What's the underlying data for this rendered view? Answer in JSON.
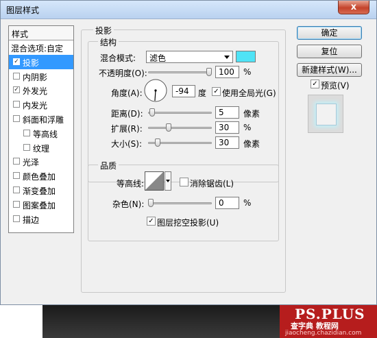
{
  "window": {
    "title": "图层样式",
    "close": "x"
  },
  "styles": {
    "header": "样式",
    "items": [
      {
        "label": "混合选项:自定",
        "checkbox": false,
        "checked": false,
        "indent": false,
        "selected": false
      },
      {
        "label": "投影",
        "checkbox": true,
        "checked": true,
        "indent": false,
        "selected": true
      },
      {
        "label": "内阴影",
        "checkbox": true,
        "checked": false,
        "indent": false,
        "selected": false
      },
      {
        "label": "外发光",
        "checkbox": true,
        "checked": true,
        "indent": false,
        "selected": false
      },
      {
        "label": "内发光",
        "checkbox": true,
        "checked": false,
        "indent": false,
        "selected": false
      },
      {
        "label": "斜面和浮雕",
        "checkbox": true,
        "checked": false,
        "indent": false,
        "selected": false
      },
      {
        "label": "等高线",
        "checkbox": true,
        "checked": false,
        "indent": true,
        "selected": false
      },
      {
        "label": "纹理",
        "checkbox": true,
        "checked": false,
        "indent": true,
        "selected": false
      },
      {
        "label": "光泽",
        "checkbox": true,
        "checked": false,
        "indent": false,
        "selected": false
      },
      {
        "label": "颜色叠加",
        "checkbox": true,
        "checked": false,
        "indent": false,
        "selected": false
      },
      {
        "label": "渐变叠加",
        "checkbox": true,
        "checked": false,
        "indent": false,
        "selected": false
      },
      {
        "label": "图案叠加",
        "checkbox": true,
        "checked": false,
        "indent": false,
        "selected": false
      },
      {
        "label": "描边",
        "checkbox": true,
        "checked": false,
        "indent": false,
        "selected": false
      }
    ]
  },
  "shadow": {
    "title": "投影",
    "structure": {
      "title": "结构",
      "blend_mode_label": "混合模式:",
      "blend_mode_value": "滤色",
      "color": "#4fe3f6",
      "opacity_label": "不透明度(O):",
      "opacity_value": "100",
      "opacity_unit": "%",
      "opacity_fraction": 1.0,
      "angle_label": "角度(A):",
      "angle_value": "-94",
      "angle_unit": "度",
      "global_light_label": "使用全局光(G)",
      "global_light_checked": true,
      "distance_label": "距离(D):",
      "distance_value": "5",
      "distance_unit": "像素",
      "distance_fraction": 0.02,
      "spread_label": "扩展(R):",
      "spread_value": "30",
      "spread_unit": "%",
      "spread_fraction": 0.3,
      "size_label": "大小(S):",
      "size_value": "30",
      "size_unit": "像素",
      "size_fraction": 0.12
    },
    "quality": {
      "title": "品质",
      "contour_label": "等高线:",
      "antialias_label": "消除锯齿(L)",
      "antialias_checked": false,
      "noise_label": "杂色(N):",
      "noise_value": "0",
      "noise_unit": "%",
      "noise_fraction": 0.0
    },
    "knockout_label": "图层挖空投影(U)",
    "knockout_checked": true
  },
  "buttons": {
    "ok": "确定",
    "reset": "复位",
    "new_style": "新建样式(W)...",
    "preview_label": "预览(V)",
    "preview_checked": true
  },
  "watermark": {
    "brand": "PS.PLUS",
    "line2": "查字典 教程网",
    "url": "jiaocheng.chazidian.com"
  }
}
